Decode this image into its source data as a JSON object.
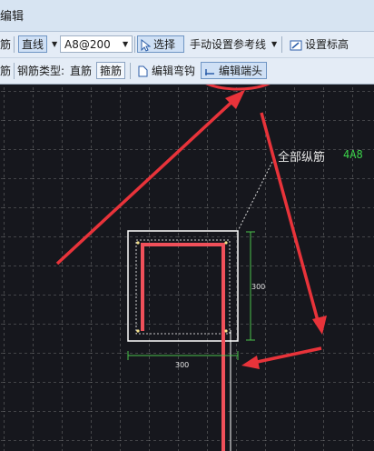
{
  "window": {
    "title": "编辑"
  },
  "toolbar1": {
    "left_fragment": "筋",
    "line_mode": "直线",
    "spec_value": "A8@200",
    "select_label": "选择",
    "manual_ref_label": "手动设置参考线",
    "set_elev_label": "设置标高"
  },
  "toolbar2": {
    "left_fragment": "筋",
    "rebar_type_label": "钢筋类型:",
    "straight_label": "直筋",
    "stirrup_label": "箍筋",
    "edit_bend_label": "编辑弯钩",
    "edit_end_label": "编辑端头"
  },
  "canvas": {
    "all_longitudinal_label": "全部纵筋",
    "longitudinal_spec": "4A8",
    "dim_height": "300",
    "dim_width": "300"
  },
  "colors": {
    "canvas_bg": "#16171d",
    "grid": "#8e8e8e",
    "rebar": "#f0505a",
    "annotation": "#e8333a",
    "dimension": "#49c04b",
    "spec_text": "#3bd34a"
  }
}
